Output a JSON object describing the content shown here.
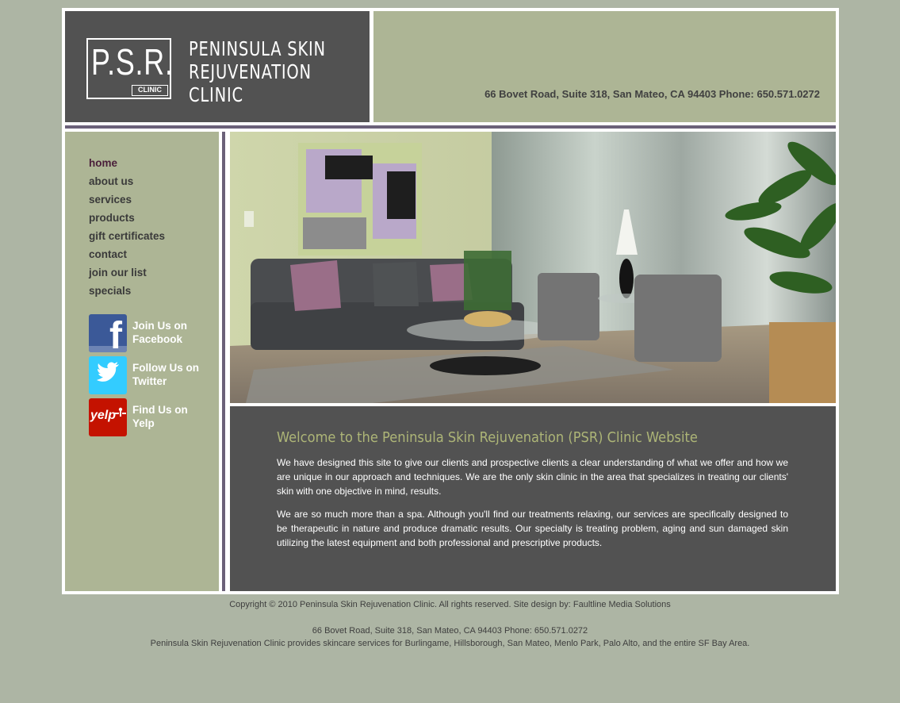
{
  "header": {
    "logo_letters": "P.S.R.",
    "logo_clinic": "CLINIC",
    "logo_name_lines": [
      "Peninsula Skin",
      "Rejuvenation",
      "Clinic"
    ],
    "address": "66 Bovet Road, Suite 318, San Mateo, CA 94403 Phone: 650.571.0272"
  },
  "nav": {
    "items": [
      "home",
      "about us",
      "services",
      "products",
      "gift certificates",
      "contact",
      "join our list",
      "specials"
    ],
    "active": "home"
  },
  "social": {
    "facebook": {
      "icon": "facebook-icon",
      "line1": "Join Us on",
      "line2": "Facebook"
    },
    "twitter": {
      "icon": "twitter-bird-icon",
      "line1": "Follow Us on",
      "line2": "Twitter"
    },
    "yelp": {
      "icon": "yelp-icon",
      "logo_text": "yelp",
      "line1": "Find Us on",
      "line2": "Yelp"
    }
  },
  "main": {
    "welcome_title": "Welcome to the Peninsula Skin Rejuvenation (PSR) Clinic Website",
    "paragraph1": "We have designed this site to give our clients and prospective clients a clear understanding of what we offer and how we are unique in our approach and techniques. We are the only skin clinic in the area that specializes in treating our clients' skin with one objective in mind, results.",
    "paragraph2": "We are so much more than a spa. Although you'll find our treatments relaxing, our services are specifically designed to be therapeutic in nature and produce dramatic results. Our specialty is treating problem, aging and sun damaged skin utilizing the latest equipment and both professional and prescriptive products."
  },
  "footer": {
    "copyright": "Copyright © 2010 Peninsula Skin Rejuvenation Clinic. All rights reserved. Site design by: Faultline Media Solutions",
    "address": "66 Bovet Road, Suite 318, San Mateo, CA 94403 Phone: 650.571.0272",
    "service_area": "Peninsula Skin Rejuvenation Clinic provides skincare services for Burlingame, Hillsborough, San Mateo, Menlo Park, Palo Alto, and the entire SF Bay Area."
  },
  "colors": {
    "page_bg": "#adb5a4",
    "panel_olive": "#adb595",
    "panel_dark": "#525252",
    "accent_purple": "#6b6179",
    "welcome_green": "#adb577"
  }
}
